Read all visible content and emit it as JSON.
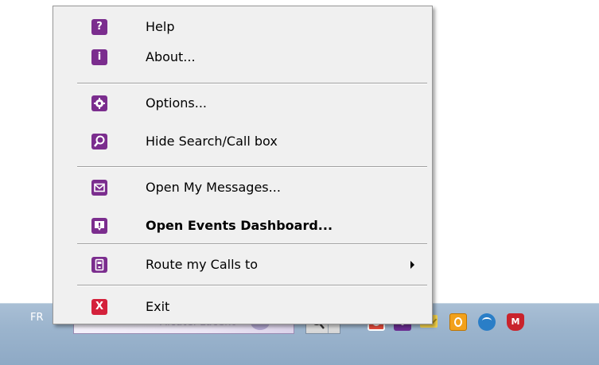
{
  "menu": {
    "items": [
      {
        "label": "Help",
        "icon": "help-icon",
        "glyph": "?"
      },
      {
        "label": "About...",
        "icon": "info-icon",
        "glyph": "i"
      },
      {
        "label": "Options...",
        "icon": "gear-icon"
      },
      {
        "label": "Hide Search/Call box",
        "icon": "search-icon"
      },
      {
        "label": "Open My Messages...",
        "icon": "envelope-icon"
      },
      {
        "label": "Open Events Dashboard...",
        "icon": "dashboard-icon",
        "bold": true
      },
      {
        "label": "Route my Calls to",
        "icon": "phone-route-icon",
        "submenu": true
      },
      {
        "label": "Exit",
        "icon": "close-icon",
        "glyph": "X"
      }
    ]
  },
  "taskbar": {
    "language": "FR",
    "search_brand": "Alcatel·Lucent",
    "brand_glyph": "a"
  },
  "colors": {
    "menu_icon": "#7b2d8e",
    "exit_icon": "#d4213b",
    "menu_background": "#f0f0f0",
    "taskbar": "#9bb4cd"
  }
}
